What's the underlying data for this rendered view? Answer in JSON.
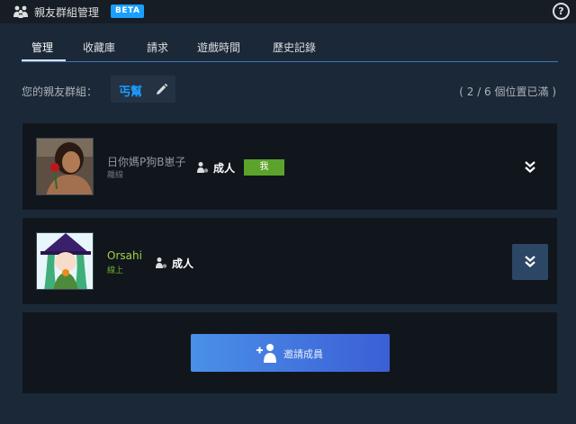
{
  "window": {
    "title": "親友群組管理",
    "beta_badge": "BETA",
    "help_icon": "?"
  },
  "tabs": [
    {
      "label": "管理",
      "active": true
    },
    {
      "label": "收藏庫",
      "active": false
    },
    {
      "label": "請求",
      "active": false
    },
    {
      "label": "遊戲時間",
      "active": false
    },
    {
      "label": "歷史記錄",
      "active": false
    }
  ],
  "group": {
    "label": "您的親友群組：",
    "name": "丐幫",
    "slots": "( 2 / 6 個位置已滿 )"
  },
  "members": [
    {
      "name": "日你媽P狗B崽子",
      "status": "離線",
      "role": "成人",
      "me_badge": "我",
      "name_color": "#8f98a0",
      "status_color": "#6b737b"
    },
    {
      "name": "Orsahi",
      "status": "線上",
      "role": "成人",
      "name_color": "#a3cf47",
      "status_color": "#6cae2d"
    }
  ],
  "invite": {
    "label": "邀請成員"
  },
  "colors": {
    "accent": "#1a9fff",
    "background": "#1b2838",
    "card": "#11161d",
    "online": "#a3cf47",
    "me_badge": "#5ba32b"
  },
  "icons": [
    "family-icon",
    "help-icon",
    "pencil-icon",
    "adult-role-icon",
    "double-chevron-down-icon",
    "add-person-icon"
  ]
}
